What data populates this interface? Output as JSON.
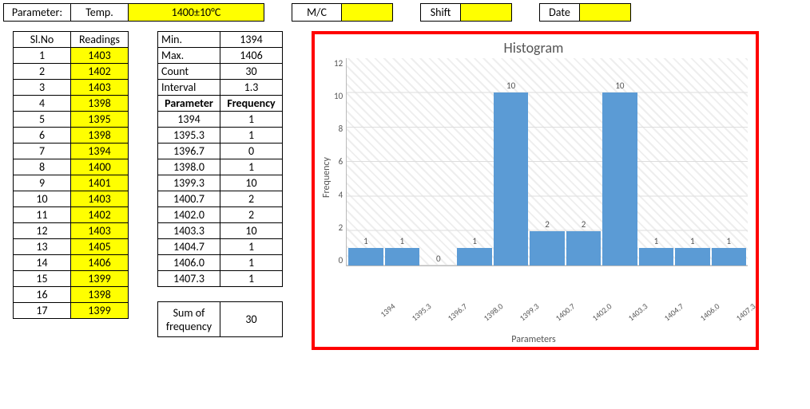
{
  "top": {
    "param_label": "Parameter:",
    "temp_label": "Temp.",
    "temp_value": "1400±10°C",
    "mc_label": "M/C",
    "mc_value": "",
    "shift_label": "Shift",
    "shift_value": "",
    "date_label": "Date",
    "date_value": ""
  },
  "readings": {
    "headers": [
      "Sl.No",
      "Readings"
    ],
    "rows": [
      [
        "1",
        "1403"
      ],
      [
        "2",
        "1402"
      ],
      [
        "3",
        "1403"
      ],
      [
        "4",
        "1398"
      ],
      [
        "5",
        "1395"
      ],
      [
        "6",
        "1398"
      ],
      [
        "7",
        "1394"
      ],
      [
        "8",
        "1400"
      ],
      [
        "9",
        "1401"
      ],
      [
        "10",
        "1403"
      ],
      [
        "11",
        "1402"
      ],
      [
        "12",
        "1403"
      ],
      [
        "13",
        "1405"
      ],
      [
        "14",
        "1406"
      ],
      [
        "15",
        "1399"
      ],
      [
        "16",
        "1398"
      ],
      [
        "17",
        "1399"
      ]
    ]
  },
  "stats": {
    "rows": [
      [
        "Min.",
        "1394"
      ],
      [
        "Max.",
        "1406"
      ],
      [
        "Count",
        "30"
      ],
      [
        "Interval",
        "1.3"
      ]
    ]
  },
  "freq": {
    "headers": [
      "Parameter",
      "Frequency"
    ],
    "rows": [
      [
        "1394",
        "1"
      ],
      [
        "1395.3",
        "1"
      ],
      [
        "1396.7",
        "0"
      ],
      [
        "1398.0",
        "1"
      ],
      [
        "1399.3",
        "10"
      ],
      [
        "1400.7",
        "2"
      ],
      [
        "1402.0",
        "2"
      ],
      [
        "1403.3",
        "10"
      ],
      [
        "1404.7",
        "1"
      ],
      [
        "1406.0",
        "1"
      ],
      [
        "1407.3",
        "1"
      ]
    ]
  },
  "sum": {
    "label": "Sum of frequency",
    "value": "30"
  },
  "chart_data": {
    "type": "bar",
    "title": "Histogram",
    "xlabel": "Parameters",
    "ylabel": "Frequency",
    "ylim": [
      0,
      12
    ],
    "yticks": [
      12,
      10,
      8,
      6,
      4,
      2,
      0
    ],
    "categories": [
      "1394",
      "1395.3",
      "1396.7",
      "1398.0",
      "1399.3",
      "1400.7",
      "1402.0",
      "1403.3",
      "1404.7",
      "1406.0",
      "1407.3"
    ],
    "values": [
      1,
      1,
      0,
      1,
      10,
      2,
      2,
      10,
      1,
      1,
      1
    ]
  }
}
